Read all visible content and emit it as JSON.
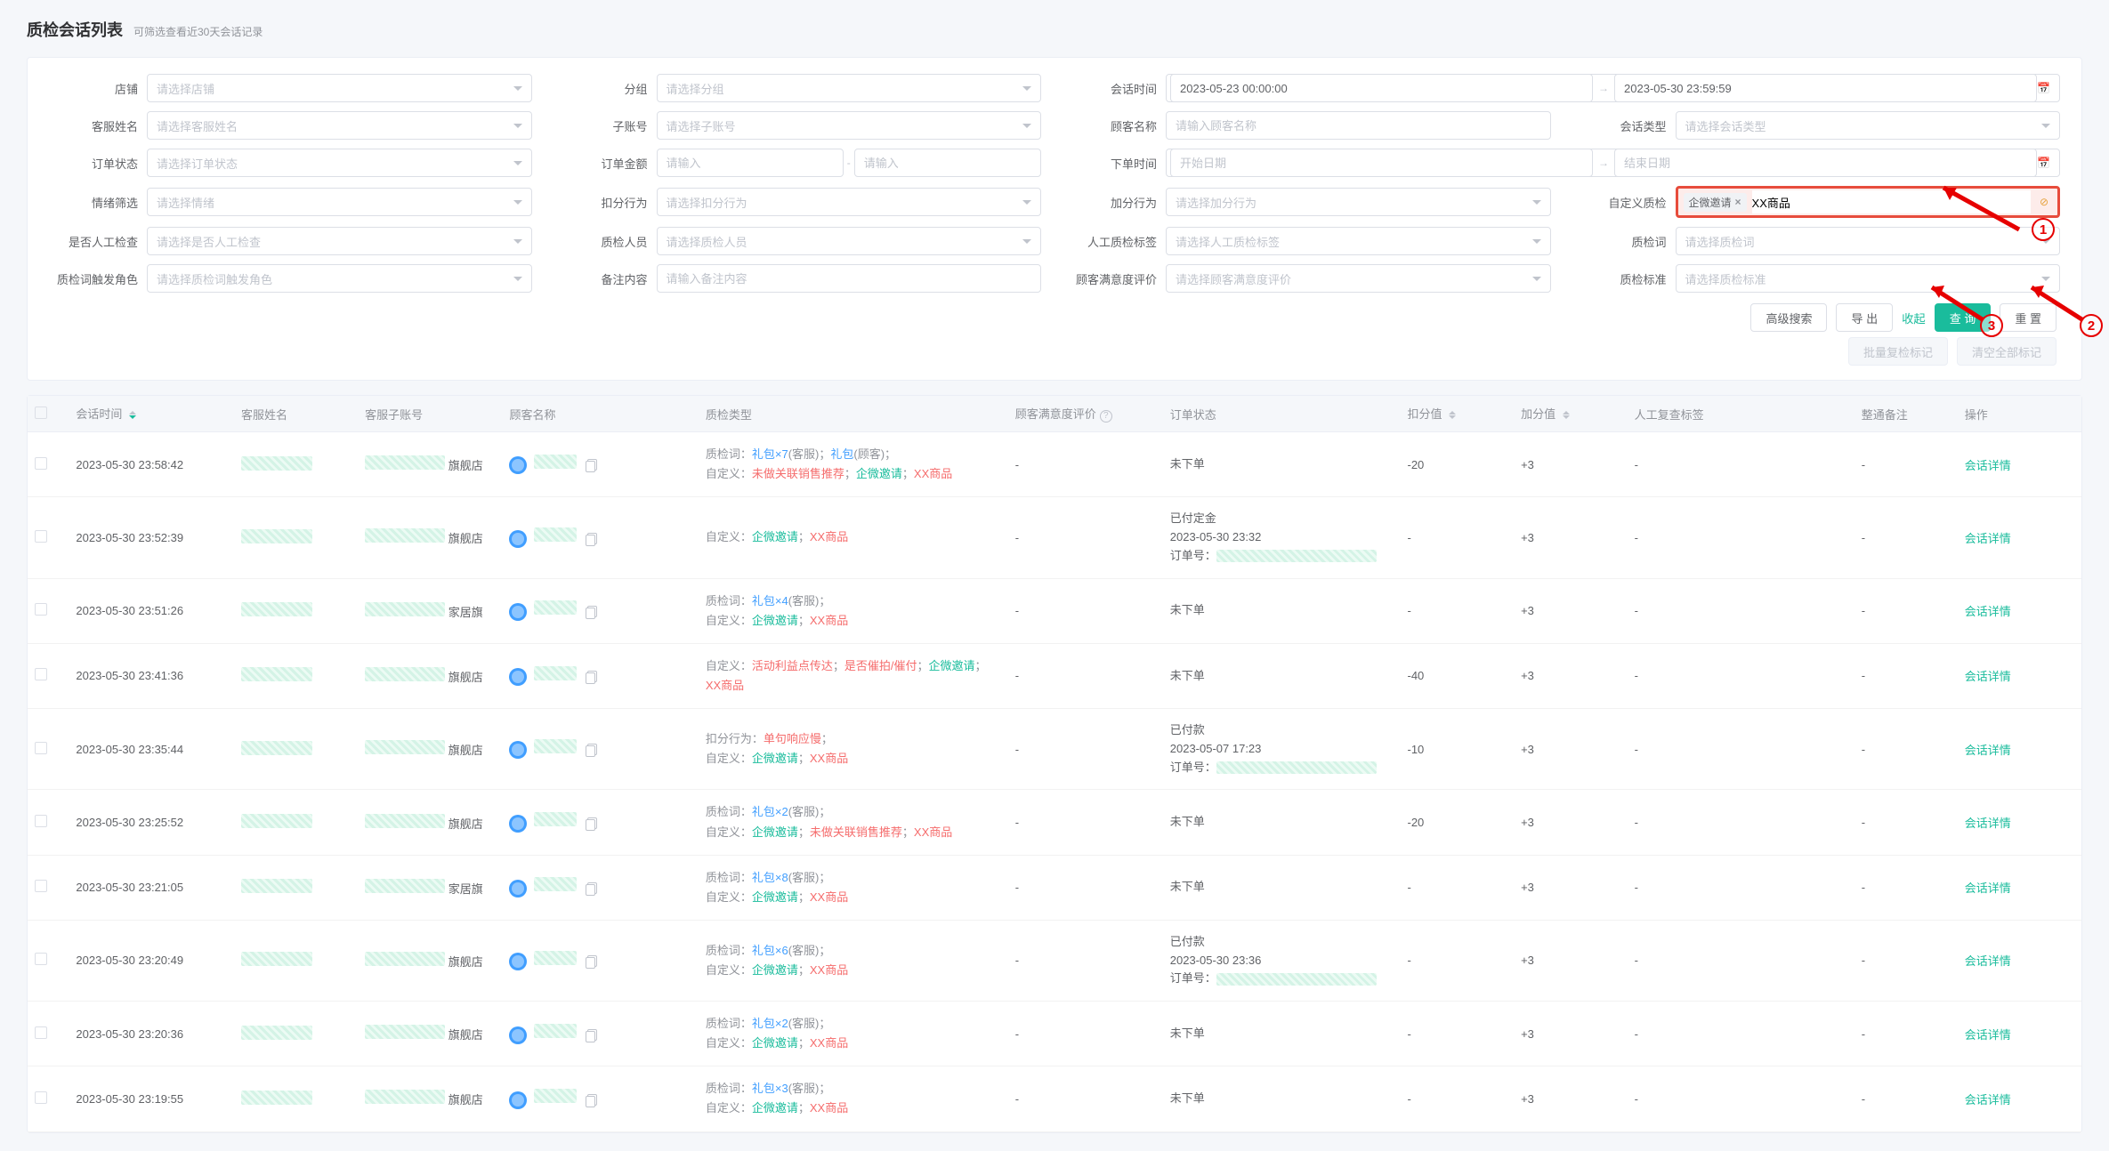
{
  "page": {
    "title": "质检会话列表",
    "subtitle": "可筛选查看近30天会话记录"
  },
  "search": {
    "labels": {
      "shop": "店铺",
      "group": "分组",
      "session_time": "会话时间",
      "agent_name": "客服姓名",
      "sub_account": "子账号",
      "customer_name": "顾客名称",
      "session_type": "会话类型",
      "order_status": "订单状态",
      "order_amount": "订单金额",
      "order_time": "下单时间",
      "emotion_filter": "情绪筛选",
      "deduct_action": "扣分行为",
      "add_action": "加分行为",
      "custom_qc": "自定义质检",
      "manual_check": "是否人工检查",
      "qc_staff": "质检人员",
      "manual_qc_tag": "人工质检标签",
      "qc_word": "质检词",
      "qc_word_role": "质检词触发角色",
      "remark": "备注内容",
      "satisfaction": "顾客满意度评价",
      "qc_standard": "质检标准"
    },
    "placeholders": {
      "shop": "请选择店铺",
      "group": "请选择分组",
      "agent_name": "请选择客服姓名",
      "sub_account": "请选择子账号",
      "customer_name": "请输入顾客名称",
      "session_type": "请选择会话类型",
      "order_status": "请选择订单状态",
      "amount_min": "请输入",
      "amount_max": "请输入",
      "order_time_start": "开始日期",
      "order_time_end": "结束日期",
      "emotion_filter": "请选择情绪",
      "deduct_action": "请选择扣分行为",
      "add_action": "请选择加分行为",
      "manual_check": "请选择是否人工检查",
      "qc_staff": "请选择质检人员",
      "manual_qc_tag": "请选择人工质检标签",
      "qc_word": "请选择质检词",
      "qc_word_role": "请选择质检词触发角色",
      "remark": "请输入备注内容",
      "satisfaction": "请选择顾客满意度评价",
      "qc_standard": "请选择质检标准"
    },
    "session_time_start": "2023-05-23 00:00:00",
    "session_time_end": "2023-05-30 23:59:59",
    "custom_qc_tag": "企微邀请",
    "custom_qc_input": "XX商品"
  },
  "actions": {
    "advanced": "高级搜索",
    "export": "导 出",
    "collapse": "收起",
    "query": "查 询",
    "reset": "重 置",
    "batch_review": "批量复检标记",
    "clear_remarks": "清空全部标记"
  },
  "columns": {
    "session_time": "会话时间",
    "agent_name": "客服姓名",
    "sub_account": "客服子账号",
    "customer": "顾客名称",
    "qc_type": "质检类型",
    "satisfaction": "顾客满意度评价",
    "order_status": "订单状态",
    "deduct": "扣分值",
    "add": "加分值",
    "review_tag": "人工复查标签",
    "remark": "整通备注",
    "ops": "操作"
  },
  "qc_labels": {
    "qc_word": "质检词：",
    "custom": "自定义：",
    "deduct_action": "扣分行为：",
    "agent_suffix": "(客服)",
    "customer_suffix": "(顾客)",
    "sep": "；",
    "order_no": "订单号："
  },
  "rows": [
    {
      "time": "2023-05-30 23:58:42",
      "sub_shop": "旗舰店",
      "qc": [
        {
          "type": "word",
          "parts": [
            {
              "t": "礼包×7",
              "c": "blue"
            },
            {
              "t": "(客服)；",
              "c": "gray"
            },
            {
              "t": "礼包",
              "c": "blue"
            },
            {
              "t": "(顾客)；",
              "c": "gray"
            }
          ]
        },
        {
          "type": "custom",
          "parts": [
            {
              "t": "未做关联销售推荐",
              "c": "red"
            },
            {
              "t": "；",
              "c": "gray"
            },
            {
              "t": "企微邀请",
              "c": "green"
            },
            {
              "t": "；",
              "c": "gray"
            },
            {
              "t": "XX商品",
              "c": "red"
            }
          ]
        }
      ],
      "sat": "-",
      "order": {
        "status": "未下单"
      },
      "deduct": "-20",
      "add": "+3",
      "review": "-",
      "remark": "-",
      "link": "会话详情"
    },
    {
      "time": "2023-05-30 23:52:39",
      "sub_shop": "旗舰店",
      "qc": [
        {
          "type": "custom",
          "parts": [
            {
              "t": "企微邀请",
              "c": "green"
            },
            {
              "t": "；",
              "c": "gray"
            },
            {
              "t": "XX商品",
              "c": "red"
            }
          ]
        }
      ],
      "sat": "-",
      "order": {
        "status": "已付定金",
        "time": "2023-05-30 23:32",
        "has_order": true
      },
      "deduct": "-",
      "add": "+3",
      "review": "-",
      "remark": "-",
      "link": "会话详情"
    },
    {
      "time": "2023-05-30 23:51:26",
      "sub_shop": "家居旗",
      "qc": [
        {
          "type": "word",
          "parts": [
            {
              "t": "礼包×4",
              "c": "blue"
            },
            {
              "t": "(客服)；",
              "c": "gray"
            }
          ]
        },
        {
          "type": "custom",
          "parts": [
            {
              "t": "企微邀请",
              "c": "green"
            },
            {
              "t": "；",
              "c": "gray"
            },
            {
              "t": "XX商品",
              "c": "red"
            }
          ]
        }
      ],
      "sat": "-",
      "order": {
        "status": "未下单"
      },
      "deduct": "-",
      "add": "+3",
      "review": "-",
      "remark": "-",
      "link": "会话详情"
    },
    {
      "time": "2023-05-30 23:41:36",
      "sub_shop": "旗舰店",
      "qc": [
        {
          "type": "custom",
          "parts": [
            {
              "t": "活动利益点传达",
              "c": "red"
            },
            {
              "t": "；",
              "c": "gray"
            },
            {
              "t": "是否催拍/催付",
              "c": "red"
            },
            {
              "t": "；",
              "c": "gray"
            },
            {
              "t": "企微邀请",
              "c": "green"
            },
            {
              "t": "；",
              "c": "gray"
            },
            {
              "t": "XX商品",
              "c": "red"
            }
          ]
        }
      ],
      "sat": "-",
      "order": {
        "status": "未下单"
      },
      "deduct": "-40",
      "add": "+3",
      "review": "-",
      "remark": "-",
      "link": "会话详情"
    },
    {
      "time": "2023-05-30 23:35:44",
      "sub_shop": "旗舰店",
      "qc": [
        {
          "type": "deduct",
          "parts": [
            {
              "t": "单句响应慢",
              "c": "red"
            },
            {
              "t": "；",
              "c": "gray"
            }
          ]
        },
        {
          "type": "custom",
          "parts": [
            {
              "t": "企微邀请",
              "c": "green"
            },
            {
              "t": "；",
              "c": "gray"
            },
            {
              "t": "XX商品",
              "c": "red"
            }
          ]
        }
      ],
      "sat": "-",
      "order": {
        "status": "已付款",
        "time": "2023-05-07 17:23",
        "has_order": true
      },
      "deduct": "-10",
      "add": "+3",
      "review": "-",
      "remark": "-",
      "link": "会话详情"
    },
    {
      "time": "2023-05-30 23:25:52",
      "sub_shop": "旗舰店",
      "qc": [
        {
          "type": "word",
          "parts": [
            {
              "t": "礼包×2",
              "c": "blue"
            },
            {
              "t": "(客服)；",
              "c": "gray"
            }
          ]
        },
        {
          "type": "custom",
          "parts": [
            {
              "t": "企微邀请",
              "c": "green"
            },
            {
              "t": "；",
              "c": "gray"
            },
            {
              "t": "未做关联销售推荐",
              "c": "red"
            },
            {
              "t": "；",
              "c": "gray"
            },
            {
              "t": "XX商品",
              "c": "red"
            }
          ]
        }
      ],
      "sat": "-",
      "order": {
        "status": "未下单"
      },
      "deduct": "-20",
      "add": "+3",
      "review": "-",
      "remark": "-",
      "link": "会话详情"
    },
    {
      "time": "2023-05-30 23:21:05",
      "sub_shop": "家居旗",
      "qc": [
        {
          "type": "word",
          "parts": [
            {
              "t": "礼包×8",
              "c": "blue"
            },
            {
              "t": "(客服)；",
              "c": "gray"
            }
          ]
        },
        {
          "type": "custom",
          "parts": [
            {
              "t": "企微邀请",
              "c": "green"
            },
            {
              "t": "；",
              "c": "gray"
            },
            {
              "t": "XX商品",
              "c": "red"
            }
          ]
        }
      ],
      "sat": "-",
      "order": {
        "status": "未下单"
      },
      "deduct": "-",
      "add": "+3",
      "review": "-",
      "remark": "-",
      "link": "会话详情"
    },
    {
      "time": "2023-05-30 23:20:49",
      "sub_shop": "旗舰店",
      "qc": [
        {
          "type": "word",
          "parts": [
            {
              "t": "礼包×6",
              "c": "blue"
            },
            {
              "t": "(客服)；",
              "c": "gray"
            }
          ]
        },
        {
          "type": "custom",
          "parts": [
            {
              "t": "企微邀请",
              "c": "green"
            },
            {
              "t": "；",
              "c": "gray"
            },
            {
              "t": "XX商品",
              "c": "red"
            }
          ]
        }
      ],
      "sat": "-",
      "order": {
        "status": "已付款",
        "time": "2023-05-30 23:36",
        "has_order": true
      },
      "deduct": "-",
      "add": "+3",
      "review": "-",
      "remark": "-",
      "link": "会话详情"
    },
    {
      "time": "2023-05-30 23:20:36",
      "sub_shop": "旗舰店",
      "qc": [
        {
          "type": "word",
          "parts": [
            {
              "t": "礼包×2",
              "c": "blue"
            },
            {
              "t": "(客服)；",
              "c": "gray"
            }
          ]
        },
        {
          "type": "custom",
          "parts": [
            {
              "t": "企微邀请",
              "c": "green"
            },
            {
              "t": "；",
              "c": "gray"
            },
            {
              "t": "XX商品",
              "c": "red"
            }
          ]
        }
      ],
      "sat": "-",
      "order": {
        "status": "未下单"
      },
      "deduct": "-",
      "add": "+3",
      "review": "-",
      "remark": "-",
      "link": "会话详情"
    },
    {
      "time": "2023-05-30 23:19:55",
      "sub_shop": "旗舰店",
      "qc": [
        {
          "type": "word",
          "parts": [
            {
              "t": "礼包×3",
              "c": "blue"
            },
            {
              "t": "(客服)；",
              "c": "gray"
            }
          ]
        },
        {
          "type": "custom",
          "parts": [
            {
              "t": "企微邀请",
              "c": "green"
            },
            {
              "t": "；",
              "c": "gray"
            },
            {
              "t": "XX商品",
              "c": "red"
            }
          ]
        }
      ],
      "sat": "-",
      "order": {
        "status": "未下单"
      },
      "deduct": "-",
      "add": "+3",
      "review": "-",
      "remark": "-",
      "link": "会话详情"
    }
  ],
  "annot": {
    "n1": "1",
    "n2": "2",
    "n3": "3"
  }
}
